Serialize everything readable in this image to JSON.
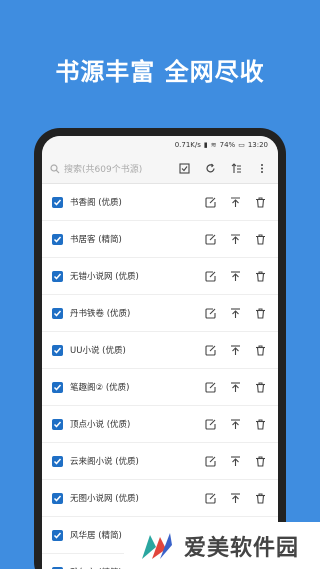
{
  "headline": "书源丰富  全网尽收",
  "status": {
    "speed": "0.71K/s",
    "battery": "74%",
    "time": "13:20"
  },
  "search": {
    "placeholder": "搜索(共609个书源)"
  },
  "sources": [
    {
      "label": "书香阁 (优质)"
    },
    {
      "label": "书居客 (精简)"
    },
    {
      "label": "无错小说网 (优质)"
    },
    {
      "label": "丹书铁卷 (优质)"
    },
    {
      "label": "UU小说 (优质)"
    },
    {
      "label": "笔趣阁② (优质)"
    },
    {
      "label": "顶点小说 (优质)"
    },
    {
      "label": "云来阁小说 (优质)"
    },
    {
      "label": "无图小说网 (优质)"
    },
    {
      "label": "风华居 (精简)"
    },
    {
      "label": "雅尔文 (精简)"
    }
  ],
  "watermark": "爱美软件园",
  "colors": {
    "background": "#3f8de0",
    "checkbox": "#1f6fc5"
  }
}
